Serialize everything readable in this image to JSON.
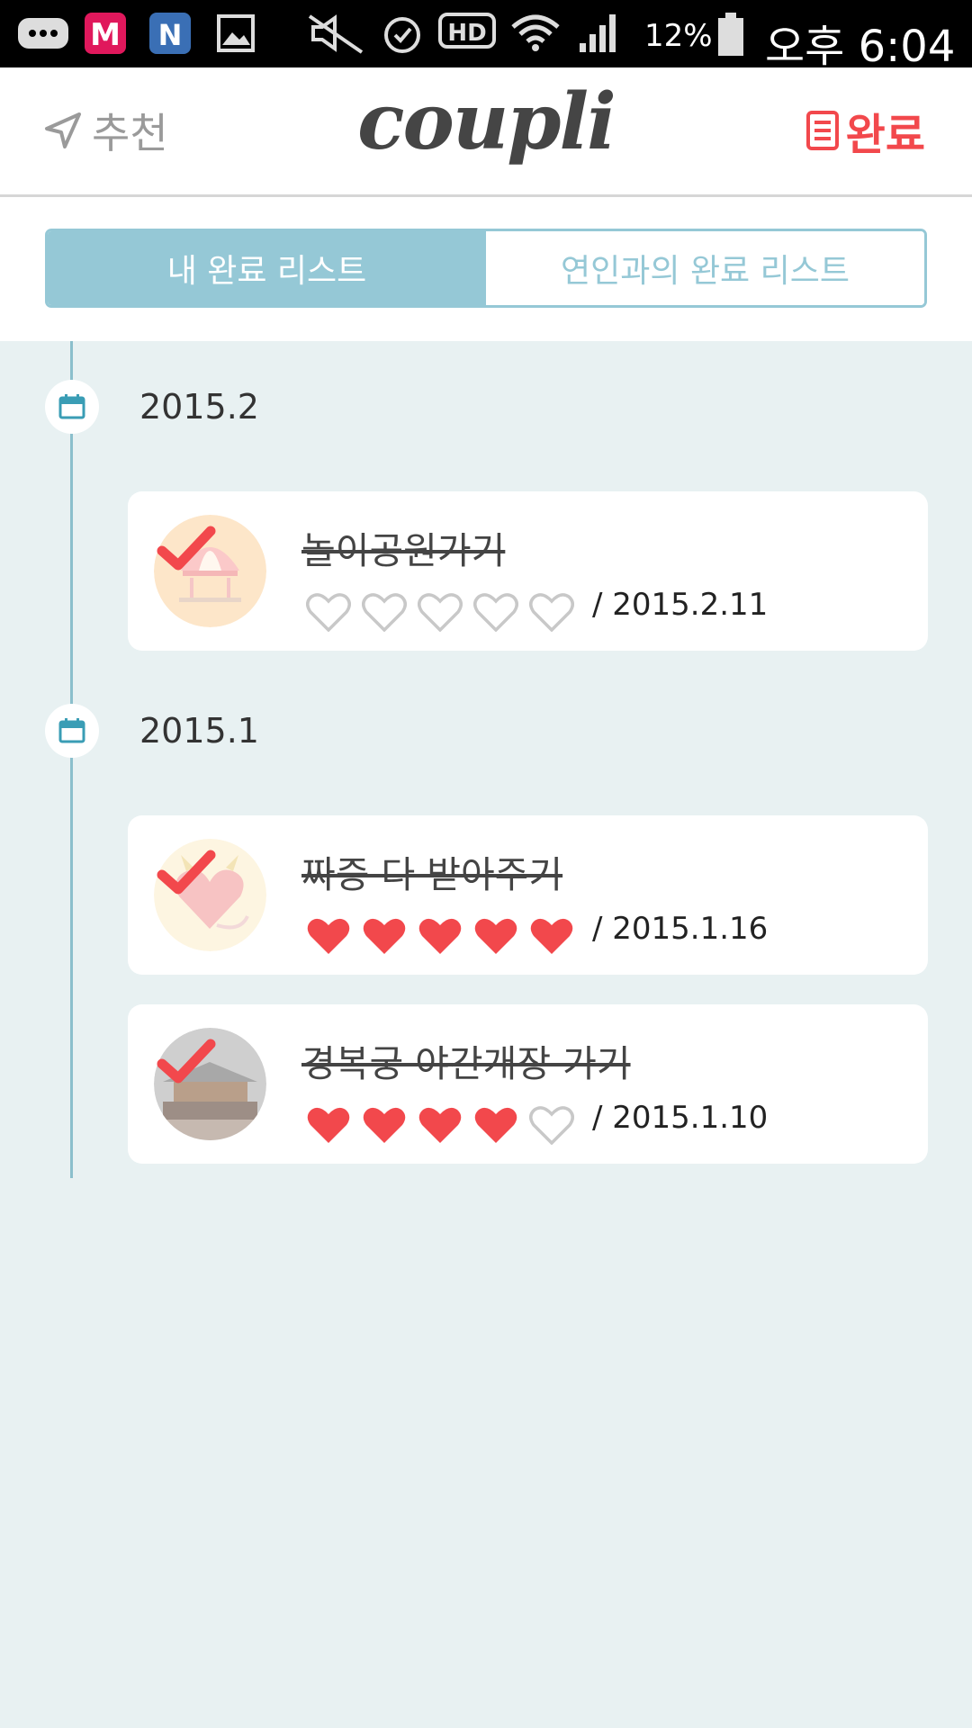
{
  "status_bar": {
    "icons": [
      "chat-icon",
      "melon-icon",
      "naver-icon",
      "gallery-icon",
      "mute-icon",
      "alarm-icon",
      "hd-icon",
      "wifi-icon",
      "signal-icon"
    ],
    "battery_text": "12%",
    "time": "오후 6:04"
  },
  "header": {
    "recommend_label": "추천",
    "logo": "coupli",
    "done_label": "완료",
    "accent_color": "#f2484c"
  },
  "tabs": [
    {
      "label": "내 완료 리스트",
      "active": true
    },
    {
      "label": "연인과의 완료 리스트",
      "active": false
    }
  ],
  "timeline": [
    {
      "month": "2015.2",
      "items": [
        {
          "title": "놀이공원가기",
          "rating": 0,
          "date": "/ 2015.2.11",
          "thumb": "amusement-park"
        }
      ]
    },
    {
      "month": "2015.1",
      "items": [
        {
          "title": "짜증 다 받아주기",
          "rating": 5,
          "date": "/ 2015.1.16",
          "thumb": "devil-heart"
        },
        {
          "title": "경복궁 야간개장 가기",
          "rating": 4,
          "date": "/ 2015.1.10",
          "thumb": "palace-night"
        }
      ]
    }
  ],
  "colors": {
    "tab_active": "#95c8d6",
    "timeline_bg": "#e8f1f2",
    "heart_filled": "#f2484c",
    "heart_empty": "#c8c8c8"
  }
}
